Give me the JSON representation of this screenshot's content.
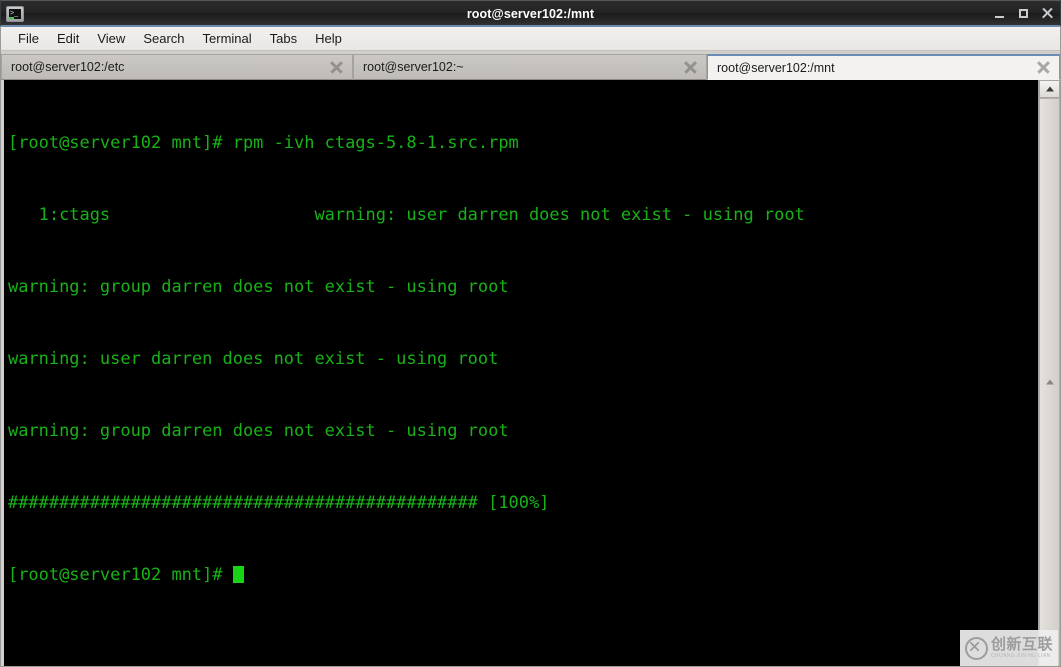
{
  "window": {
    "title": "root@server102:/mnt",
    "icon": "terminal-icon",
    "controls": {
      "minimize": "minimize-icon",
      "maximize": "maximize-icon",
      "close": "close-icon"
    }
  },
  "menubar": {
    "items": [
      {
        "label": "File"
      },
      {
        "label": "Edit"
      },
      {
        "label": "View"
      },
      {
        "label": "Search"
      },
      {
        "label": "Terminal"
      },
      {
        "label": "Tabs"
      },
      {
        "label": "Help"
      }
    ]
  },
  "tabs": [
    {
      "label": "root@server102:/etc",
      "active": false
    },
    {
      "label": "root@server102:~",
      "active": false
    },
    {
      "label": "root@server102:/mnt",
      "active": true
    }
  ],
  "terminal": {
    "foreground_color": "#18b218",
    "background_color": "#000000",
    "cursor_color": "#17d417",
    "lines": [
      "[root@server102 mnt]# rpm -ivh ctags-5.8-1.src.rpm",
      "   1:ctags                    warning: user darren does not exist - using root",
      "warning: group darren does not exist - using root",
      "warning: user darren does not exist - using root",
      "warning: group darren does not exist - using root",
      "############################################## [100%]",
      "[root@server102 mnt]# "
    ]
  },
  "scrollbar": {
    "up_arrow": "chevron-up-icon",
    "thumb_marker": "chevron-up-icon"
  },
  "watermark": {
    "cn": "创新互联",
    "en": "CHUANG XIN HU LIAN"
  }
}
